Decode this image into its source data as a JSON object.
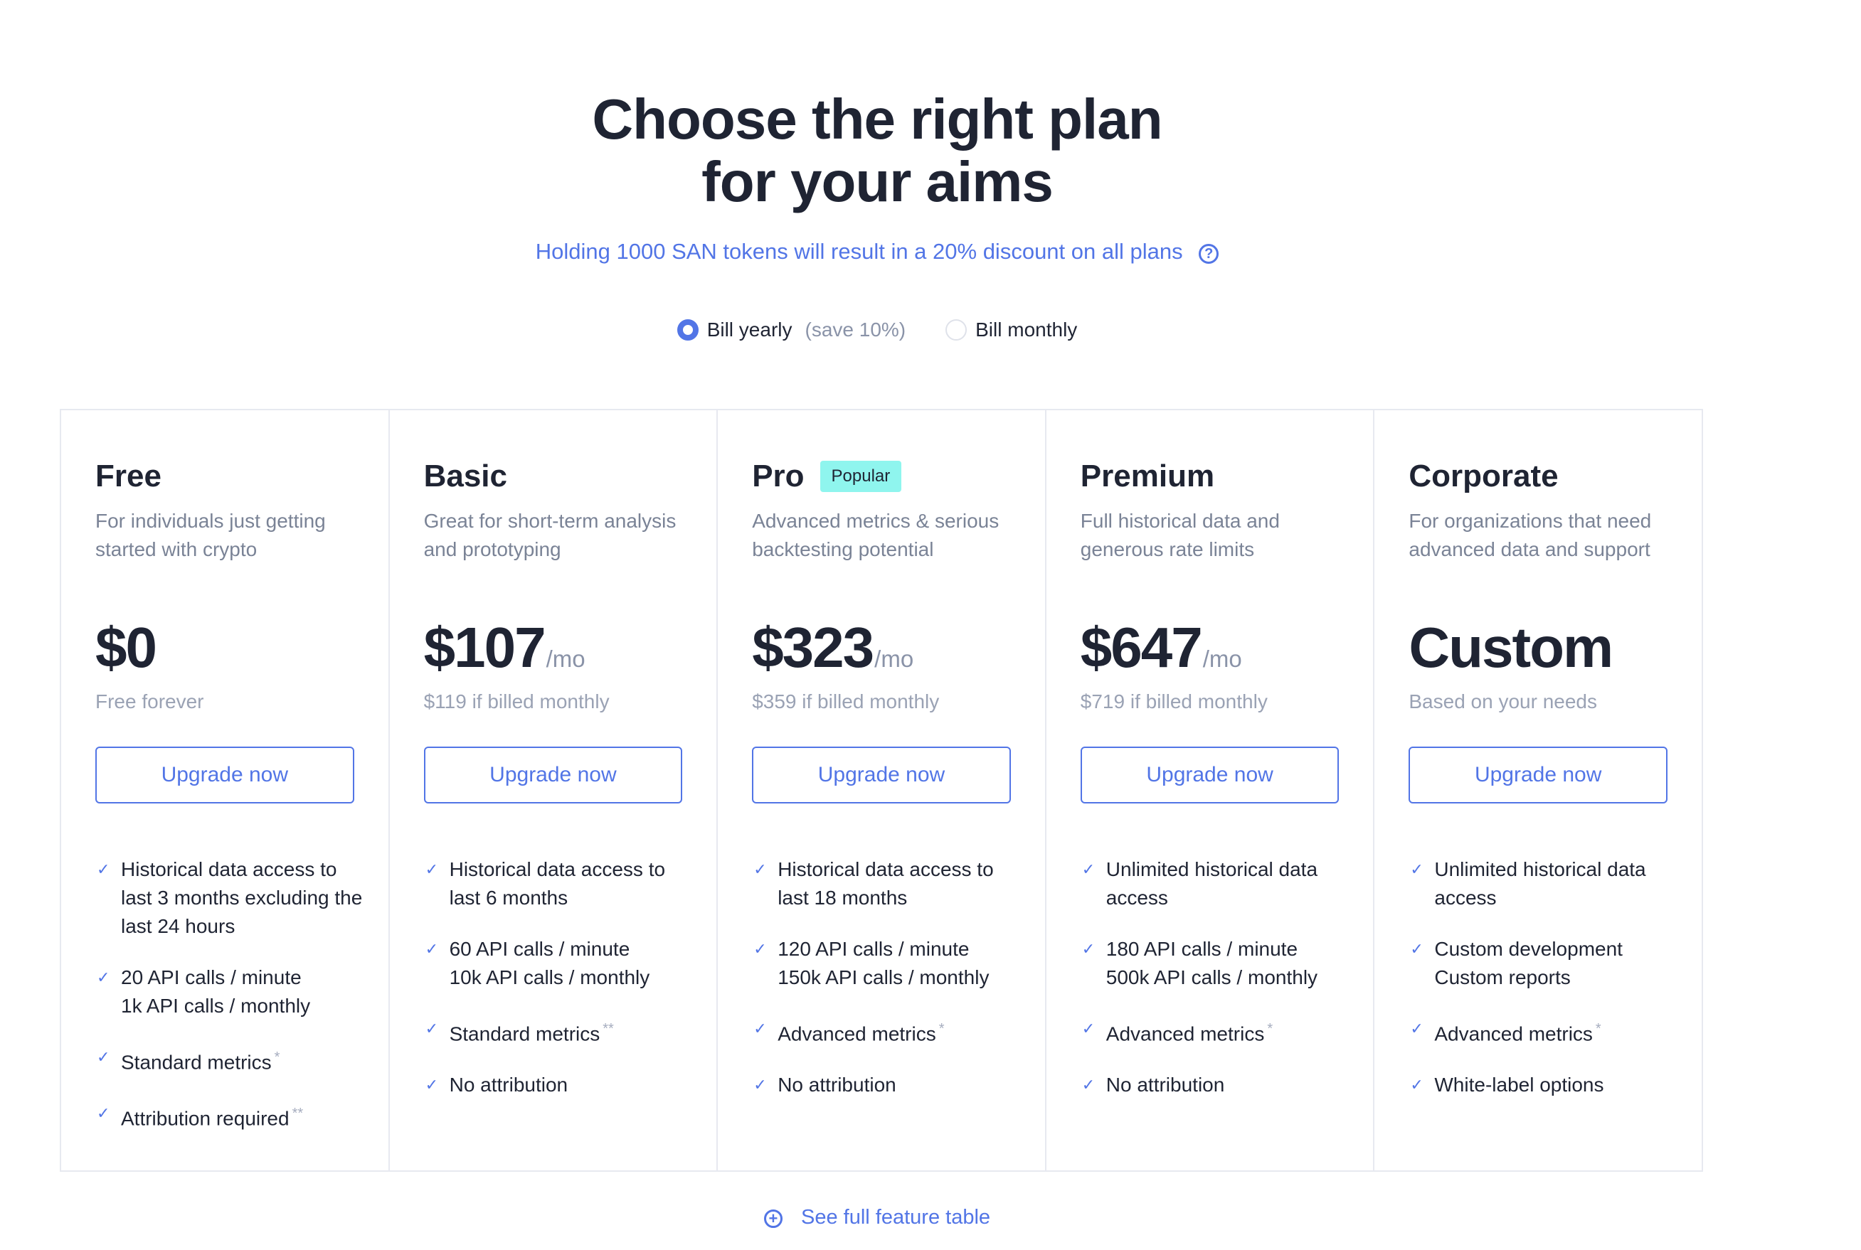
{
  "headline": {
    "line1": "Choose the right plan",
    "line2": "for your aims"
  },
  "discount": {
    "text": "Holding 1000 SAN tokens will result in a 20% discount on all plans",
    "icon": "question-circle-icon"
  },
  "billing": {
    "yearly_label": "Bill yearly",
    "yearly_note": "(save 10%)",
    "monthly_label": "Bill monthly",
    "selected": "yearly"
  },
  "plans": [
    {
      "name": "Free",
      "badge": "",
      "description": "For individuals just getting started with crypto",
      "price": "$0",
      "unit": "",
      "note": "Free forever",
      "button": "Upgrade now",
      "features": [
        {
          "lines": [
            "Historical data access to last 3 months excluding the last 24 hours"
          ],
          "mark": ""
        },
        {
          "lines": [
            "20 API calls / minute",
            "1k API calls / monthly"
          ],
          "mark": ""
        },
        {
          "lines": [
            "Standard metrics"
          ],
          "mark": "*"
        },
        {
          "lines": [
            "Attribution required"
          ],
          "mark": "**"
        }
      ]
    },
    {
      "name": "Basic",
      "badge": "",
      "description": "Great for short-term analysis and prototyping",
      "price": "$107",
      "unit": "/mo",
      "note": "$119 if billed monthly",
      "button": "Upgrade now",
      "features": [
        {
          "lines": [
            "Historical data access to last 6 months"
          ],
          "mark": ""
        },
        {
          "lines": [
            "60 API calls / minute",
            "10k API calls / monthly"
          ],
          "mark": ""
        },
        {
          "lines": [
            "Standard metrics"
          ],
          "mark": "**"
        },
        {
          "lines": [
            "No attribution"
          ],
          "mark": ""
        }
      ]
    },
    {
      "name": "Pro",
      "badge": "Popular",
      "description": "Advanced metrics & serious backtesting potential",
      "price": "$323",
      "unit": "/mo",
      "note": "$359 if billed monthly",
      "button": "Upgrade now",
      "features": [
        {
          "lines": [
            "Historical data access to last 18 months"
          ],
          "mark": ""
        },
        {
          "lines": [
            "120 API calls / minute",
            "150k API calls / monthly"
          ],
          "mark": ""
        },
        {
          "lines": [
            "Advanced metrics"
          ],
          "mark": "*"
        },
        {
          "lines": [
            "No attribution"
          ],
          "mark": ""
        }
      ]
    },
    {
      "name": "Premium",
      "badge": "",
      "description": "Full historical data and generous rate limits",
      "price": "$647",
      "unit": "/mo",
      "note": "$719 if billed monthly",
      "button": "Upgrade now",
      "features": [
        {
          "lines": [
            "Unlimited historical data access"
          ],
          "mark": ""
        },
        {
          "lines": [
            "180 API calls / minute",
            "500k API calls / monthly"
          ],
          "mark": ""
        },
        {
          "lines": [
            "Advanced metrics"
          ],
          "mark": "*"
        },
        {
          "lines": [
            "No attribution"
          ],
          "mark": ""
        }
      ]
    },
    {
      "name": "Corporate",
      "badge": "",
      "description": "For organizations that need advanced data and support",
      "price": "Custom",
      "unit": "",
      "note": "Based on your needs",
      "button": "Upgrade now",
      "features": [
        {
          "lines": [
            "Unlimited historical data access"
          ],
          "mark": ""
        },
        {
          "lines": [
            "Custom development",
            "Custom reports"
          ],
          "mark": ""
        },
        {
          "lines": [
            "Advanced metrics"
          ],
          "mark": "*"
        },
        {
          "lines": [
            "White-label options"
          ],
          "mark": ""
        }
      ]
    }
  ],
  "footer_link": {
    "text": "See full feature table",
    "icon": "plus-circle-icon"
  },
  "colors": {
    "accent": "#5275e6",
    "badge": "#8ff5ee",
    "text": "#1f2433",
    "muted": "#7a8396"
  }
}
